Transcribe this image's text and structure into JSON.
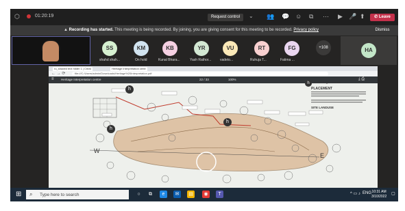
{
  "meeting": {
    "timer": "01:20:19",
    "request_control": "Request control",
    "leave": "Leave",
    "banner_bold": "Recording has started.",
    "banner_text": " This meeting is being recorded. By joining, you are giving consent for this meeting to be recorded. ",
    "privacy_link": "Privacy policy",
    "dismiss": "Dismiss"
  },
  "participants": [
    {
      "initials": "SS",
      "name": "shahd shah...",
      "color": "#d6f0d0"
    },
    {
      "initials": "KM",
      "name": "On hold",
      "color": "#d2e4f0"
    },
    {
      "initials": "KB",
      "name": "Kunal Bhara...",
      "color": "#f5d0e2"
    },
    {
      "initials": "YR",
      "name": "Yash Rathor...",
      "color": "#d3e8d3"
    },
    {
      "initials": "VU",
      "name": "vadeto...",
      "color": "#fbe9b8"
    },
    {
      "initials": "RT",
      "name": "Ruhuja T...",
      "color": "#f8d0d0"
    },
    {
      "initials": "FG",
      "name": "Fatima ...",
      "color": "#ead6f0"
    }
  ],
  "more_count": "+108",
  "ha_initials": "HA",
  "shared_screen": {
    "tab1": "ro_shaded text hilder 1 | Creat",
    "tab2": "Heritage Interpretation centr",
    "address": "file:///C:/Users/admin/Downloads/Heritage%20Interpretation.pdf",
    "viewer_title": "Heritage Interpretation centre",
    "page": "22 / 33",
    "zoom": "100%",
    "map_labels": {
      "west": "W",
      "east": "E",
      "h": "h",
      "title": "h - heritage centres",
      "heading": "PLACEMENT",
      "site_landuse": "SITE LANDUSE"
    }
  },
  "taskbar": {
    "search_placeholder": "Type here to search",
    "language": "ENG",
    "time": "10:31 AM",
    "date": "3/10/2022"
  }
}
